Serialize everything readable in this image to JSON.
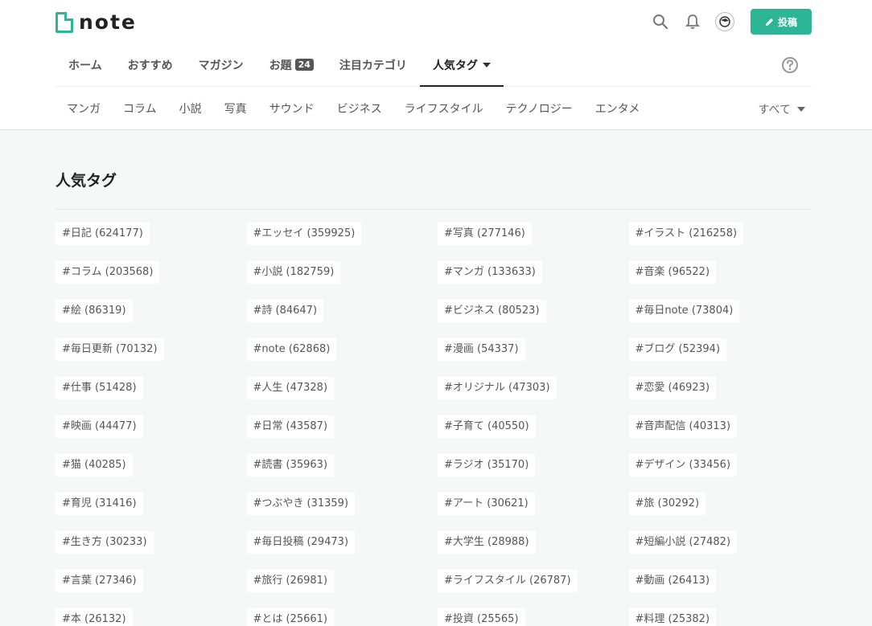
{
  "header": {
    "logo_text": "note",
    "post_label": "投稿",
    "accent_color": "#2cb696"
  },
  "nav": {
    "items": [
      {
        "label": "ホーム"
      },
      {
        "label": "おすすめ"
      },
      {
        "label": "マガジン"
      },
      {
        "label": "お題",
        "badge": "24"
      },
      {
        "label": "注目カテゴリ"
      },
      {
        "label": "人気タグ",
        "active": true
      }
    ]
  },
  "subnav": {
    "items": [
      "マンガ",
      "コラム",
      "小説",
      "写真",
      "サウンド",
      "ビジネス",
      "ライフスタイル",
      "テクノロジー",
      "エンタメ"
    ],
    "all_label": "すべて"
  },
  "page": {
    "title": "人気タグ"
  },
  "tags": [
    "#日記 (624177)",
    "#エッセイ (359925)",
    "#写真 (277146)",
    "#イラスト (216258)",
    "#コラム (203568)",
    "#小説 (182759)",
    "#マンガ (133633)",
    "#音楽 (96522)",
    "#絵 (86319)",
    "#詩 (84647)",
    "#ビジネス (80523)",
    "#毎日note (73804)",
    "#毎日更新 (70132)",
    "#note (62868)",
    "#漫画 (54337)",
    "#ブログ (52394)",
    "#仕事 (51428)",
    "#人生 (47328)",
    "#オリジナル (47303)",
    "#恋愛 (46923)",
    "#映画 (44477)",
    "#日常 (43587)",
    "#子育て (40550)",
    "#音声配信 (40313)",
    "#猫 (40285)",
    "#読書 (35963)",
    "#ラジオ (35170)",
    "#デザイン (33456)",
    "#育児 (31416)",
    "#つぶやき (31359)",
    "#アート (30621)",
    "#旅 (30292)",
    "#生き方 (30233)",
    "#毎日投稿 (29473)",
    "#大学生 (28988)",
    "#短編小説 (27482)",
    "#言葉 (27346)",
    "#旅行 (26981)",
    "#ライフスタイル (26787)",
    "#動画 (26413)",
    "#本 (26132)",
    "#とは (25661)",
    "#投資 (25565)",
    "#料理 (25382)"
  ]
}
